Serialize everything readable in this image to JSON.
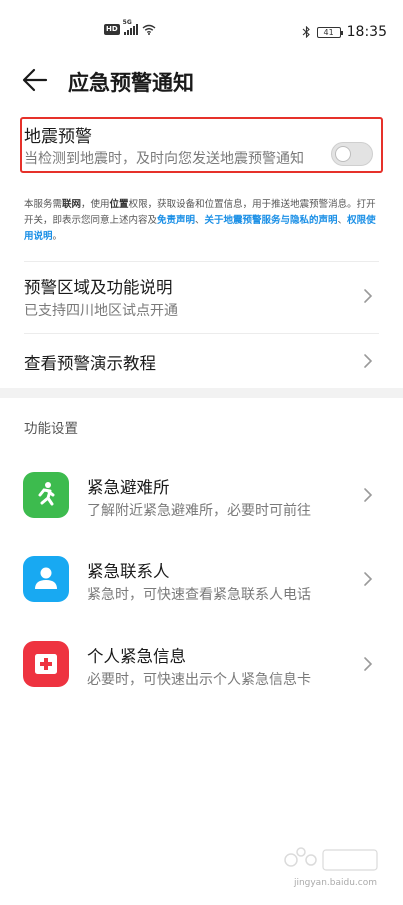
{
  "status_bar": {
    "hd": "HD",
    "network": "5G",
    "battery": "41",
    "time": "18:35"
  },
  "header": {
    "title": "应急预警通知"
  },
  "earthquake": {
    "title": "地震预警",
    "description": "当检测到地震时，及时向您发送地震预警通知",
    "toggle_on": false
  },
  "notice": {
    "p1": "本服务需",
    "b1": "联网",
    "p2": "，使用",
    "b2": "位置",
    "p3": "权限，获取设备和位置信息，用于推送地震预警消息。打开开关，即表示您同意上述内容及",
    "link1": "免责声明",
    "p4": "、",
    "link2": "关于地震预警服务与隐私的声明",
    "p5": "、",
    "link3": "权限使用说明",
    "p6": "。"
  },
  "rows": {
    "region": {
      "title": "预警区域及功能说明",
      "subtitle": "已支持四川地区试点开通"
    },
    "tutorial": {
      "title": "查看预警演示教程"
    }
  },
  "section": {
    "label": "功能设置"
  },
  "items": [
    {
      "title": "紧急避难所",
      "subtitle": "了解附近紧急避难所，必要时可前往",
      "icon": "running-person-icon",
      "color": "#3dbb4e"
    },
    {
      "title": "紧急联系人",
      "subtitle": "紧急时，可快速查看紧急联系人电话",
      "icon": "contact-person-icon",
      "color": "#18a9f2"
    },
    {
      "title": "个人紧急信息",
      "subtitle": "必要时，可快速出示个人紧急信息卡",
      "icon": "medical-cross-icon",
      "color": "#ee3340"
    }
  ],
  "watermark": {
    "text": "jingyan.baidu.com"
  }
}
